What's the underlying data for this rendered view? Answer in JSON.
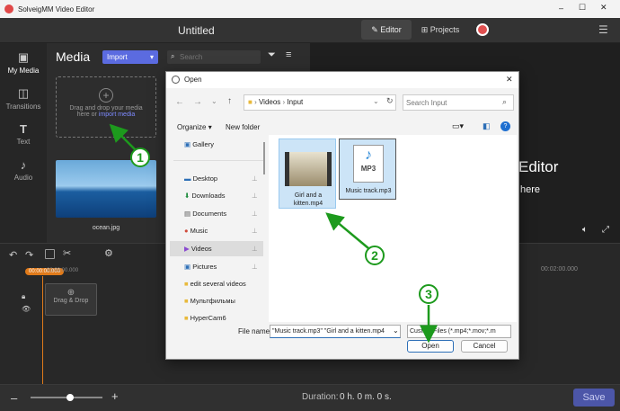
{
  "window": {
    "title": "SolveigMM Video Editor",
    "minimize": "–",
    "maximize": "☐",
    "close": "✕"
  },
  "appbar": {
    "title": "Untitled",
    "editor": "Editor",
    "projects": "Projects",
    "menu": "☰"
  },
  "leftnav": [
    {
      "label": "My Media",
      "icon": "film-icon"
    },
    {
      "label": "Transitions",
      "icon": "transitions-icon"
    },
    {
      "label": "Text",
      "icon": "text-icon"
    },
    {
      "label": "Audio",
      "icon": "audio-icon"
    }
  ],
  "media": {
    "title": "Media",
    "import_label": "Import",
    "search_placeholder": "Search",
    "drop_text_1": "Drag and drop your media",
    "drop_text_2": "here or",
    "drop_link": "import media",
    "thumb_label": "ocean.jpg"
  },
  "preview": {
    "line1": "Editor",
    "line2": "here"
  },
  "timeline": {
    "timecode_start": "00:00:00.000",
    "tick_start": "00:00:00.000",
    "tick_end": "00:02:00.000",
    "drag_drop": "Drag & Drop"
  },
  "bottom": {
    "duration_label": "Duration:",
    "duration_value": "0 h. 0 m. 0 s.",
    "save_label": "Save",
    "zoom_level": 0.55
  },
  "dialog": {
    "title": "Open",
    "path_parts": [
      "Videos",
      "Input"
    ],
    "search_placeholder": "Search Input",
    "organize": "Organize",
    "new_folder": "New folder",
    "sidebar": [
      "Gallery",
      "Desktop",
      "Downloads",
      "Documents",
      "Music",
      "Videos",
      "Pictures",
      "edit several videos",
      "Мультфильмы",
      "HyperCam6"
    ],
    "files": [
      {
        "name": "Girl and a kitten.mp4",
        "type": "video"
      },
      {
        "name": "Music track.mp3",
        "type": "audio",
        "badge": "MP3"
      }
    ],
    "filename_label": "File name:",
    "filename_value": "\"Music track.mp3\" \"Girl and a kitten.mp4",
    "filetype_value": "Custom Files (*.mp4;*.mov;*.m",
    "open_label": "Open",
    "cancel_label": "Cancel",
    "close": "✕"
  },
  "annotations": [
    "1",
    "2",
    "3"
  ],
  "colors": {
    "accent": "#5b6be0",
    "annotation": "#1d9a1d",
    "selection": "#cce4f7"
  }
}
